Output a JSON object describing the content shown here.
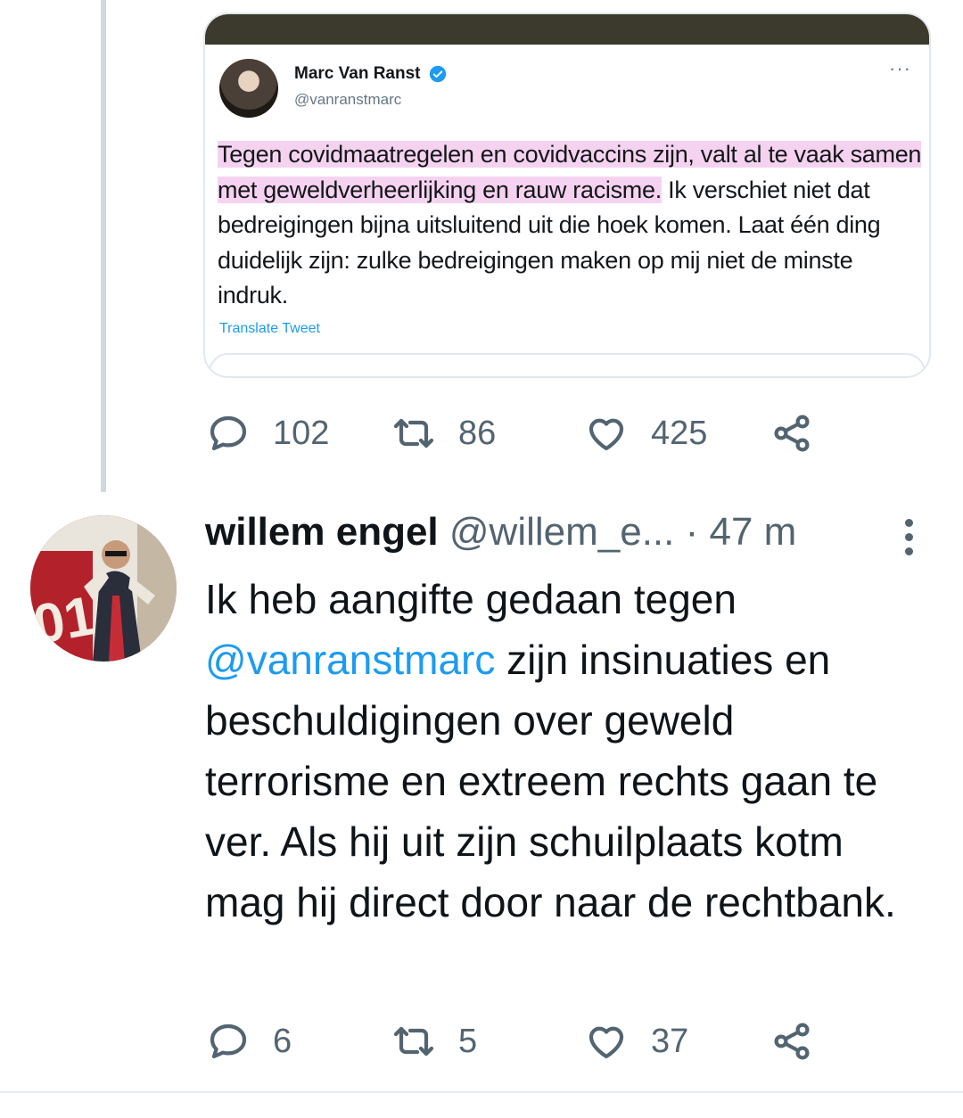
{
  "quoted_tweet": {
    "author_name": "Marc Van Ranst",
    "verified": true,
    "handle": "@vanranstmarc",
    "more_label": "···",
    "text_highlighted": "Tegen covidmaatregelen en covidvaccins zijn, valt al te vaak samen met geweldverheerlijking en rauw racisme.",
    "text_rest": "Ik verschiet niet dat bedreigingen bijna uitsluitend uit die hoek komen. Laat één ding duidelijk zijn: zulke bedreigingen maken op mij niet de minste indruk.",
    "translate_label": "Translate Tweet",
    "highlight_color": "#f5d3f0"
  },
  "tweet1_actions": {
    "replies": "102",
    "retweets": "86",
    "likes": "425"
  },
  "tweet2": {
    "author_name": "willem engel",
    "handle": "@willem_e...",
    "time": "· 47 m",
    "text_before_mention": "Ik heb aangifte gedaan tegen ",
    "mention": "@vanranstmarc",
    "text_after_mention": " zijn insinuaties en beschuldigingen over geweld terrorisme en extreem rechts gaan te ver. Als hij uit zijn schuilplaats kotm mag hij direct door naar de rechtbank.",
    "actions": {
      "replies": "6",
      "retweets": "5",
      "likes": "37"
    }
  },
  "icons": {
    "reply": "reply-icon",
    "retweet": "retweet-icon",
    "like": "heart-icon",
    "share": "share-icon",
    "more": "more-icon",
    "verified": "verified-badge-icon"
  },
  "colors": {
    "link": "#1d9bf0",
    "muted": "#536471",
    "thread_line": "#cfd9de"
  }
}
